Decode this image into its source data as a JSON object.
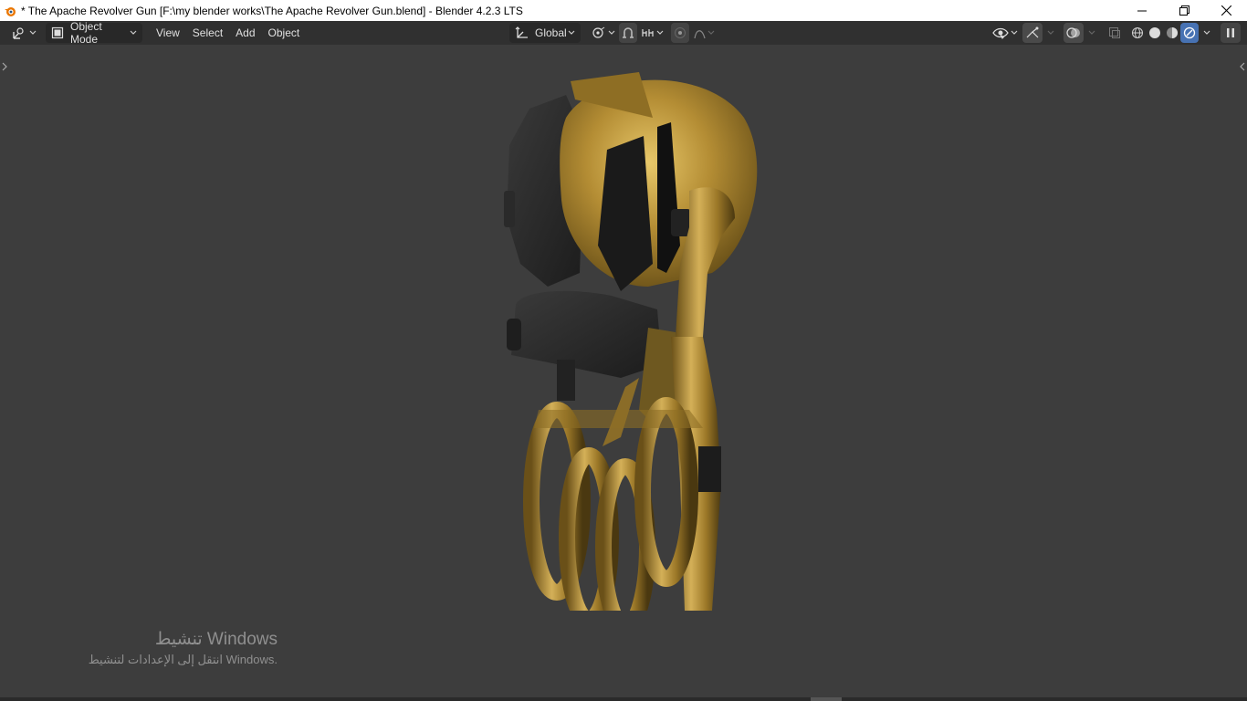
{
  "window": {
    "title": "* The Apache Revolver Gun [F:\\my blender works\\The Apache Revolver Gun.blend] - Blender 4.2.3 LTS"
  },
  "header": {
    "mode_label": "Object Mode",
    "menus": [
      "View",
      "Select",
      "Add",
      "Object"
    ],
    "orientation_label": "Global"
  },
  "watermark": {
    "line1": "تنشيط Windows",
    "line2": "انتقل إلى الإعدادات لتنشيط Windows."
  },
  "icons": {
    "app": "blender-icon",
    "editor": "editor-type-icon",
    "mode": "object-mode-icon",
    "orientation": "transform-orientation-icon",
    "pivot": "pivot-point-icon",
    "snap": "snap-icon",
    "snap_target": "snap-increment-icon",
    "proportional": "proportional-edit-icon",
    "falloff": "falloff-icon",
    "visibility": "visibility-icon",
    "gizmo": "gizmo-icon",
    "overlay": "overlay-icon",
    "xray": "xray-icon",
    "shading": [
      "wireframe-icon",
      "solid-icon",
      "material-preview-icon",
      "rendered-icon"
    ]
  },
  "colors": {
    "titlebar": "#ffffff",
    "header": "#303030",
    "viewport": "#3d3d3d",
    "accent": "#4772b3",
    "model_gold": "#b8953a",
    "model_dark": "#2b2b2b"
  }
}
